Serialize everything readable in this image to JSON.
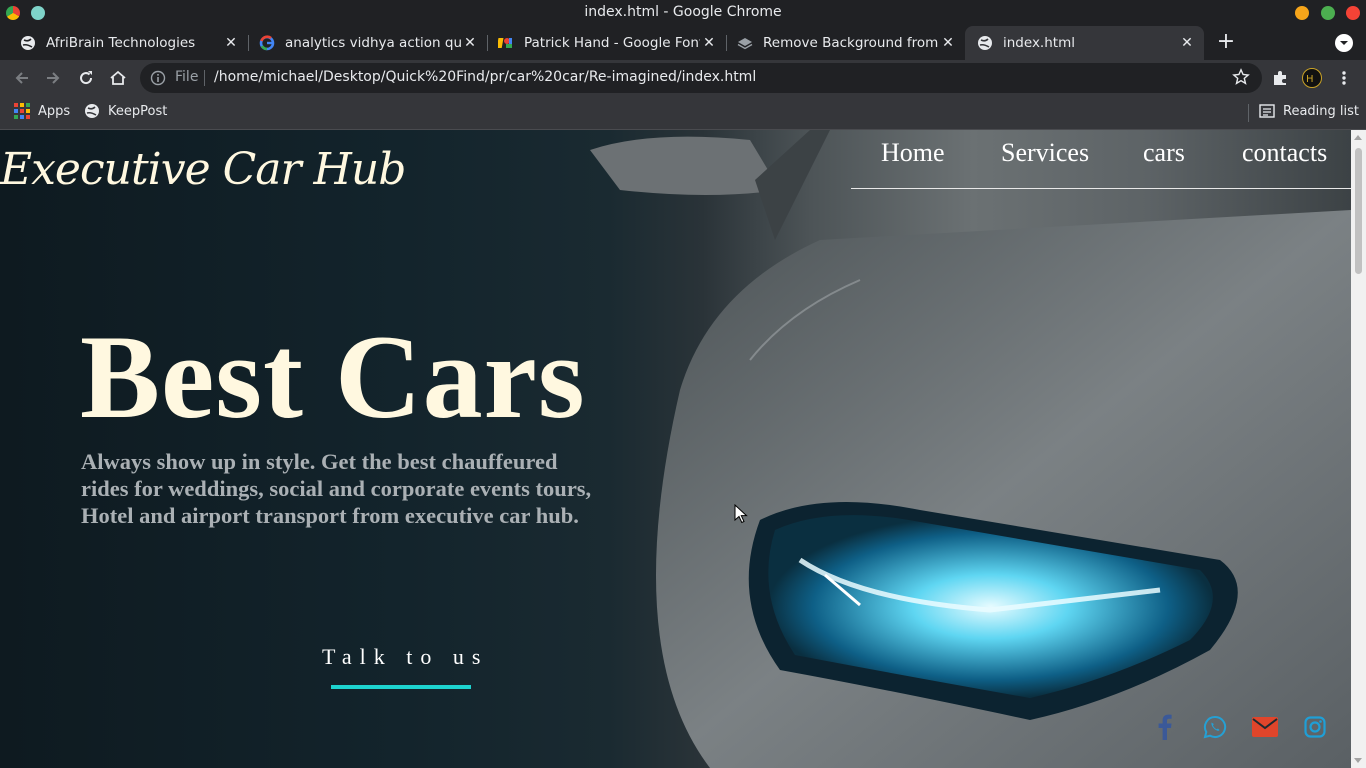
{
  "window": {
    "title": "index.html - Google Chrome"
  },
  "tabs": [
    {
      "label": "AfriBrain Technologies"
    },
    {
      "label": "analytics vidhya action quote"
    },
    {
      "label": "Patrick Hand - Google Fonts"
    },
    {
      "label": "Remove Background from Im"
    },
    {
      "label": "index.html"
    }
  ],
  "omnibox": {
    "scheme": "File",
    "url": "/home/michael/Desktop/Quick%20Find/pr/car%20car/Re-imagined/index.html"
  },
  "bookmarks": {
    "apps": "Apps",
    "keeppost": "KeepPost",
    "reading_list": "Reading list"
  },
  "page": {
    "logo": "Executive Car Hub",
    "nav": [
      "Home",
      "Services",
      "cars",
      "contacts"
    ],
    "hero_title": "Best Cars",
    "hero_text": "Always show up in style. Get the best chauffeured rides for weddings, social and corporate events tours, Hotel and airport transport from executive car hub.",
    "cta": "Talk to us",
    "social": [
      "facebook-icon",
      "whatsapp-icon",
      "email-icon",
      "instagram-icon"
    ]
  },
  "colors": {
    "accent_cyan": "#1dd3cf",
    "facebook": "#3b5998",
    "whatsapp": "#25a0d4",
    "email": "#e0452b",
    "instagram": "#1f9fd6"
  }
}
